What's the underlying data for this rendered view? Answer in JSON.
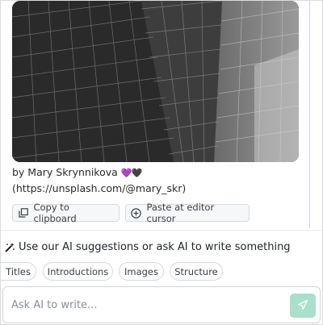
{
  "photo": {
    "credit_line1": "by Mary Skrynnikova",
    "credit_hearts": "💜🖤",
    "credit_line2": "(https://unsplash.com/@mary_skr)"
  },
  "actions": {
    "copy_label": "Copy to clipboard",
    "paste_label": "Paste at editor cursor"
  },
  "ai": {
    "suggestion_text": "Use our AI suggestions or ask AI to write something",
    "chips": [
      "Titles",
      "Introductions",
      "Images",
      "Structure"
    ],
    "input_placeholder": "Ask AI to write..."
  },
  "colors": {
    "send_button": "#a8e0cc",
    "accent_line": "#d9c7f3"
  },
  "icons": {
    "copy": "copy-icon",
    "paste": "plus-circle-icon",
    "wand": "magic-wand-icon",
    "send": "send-icon"
  }
}
